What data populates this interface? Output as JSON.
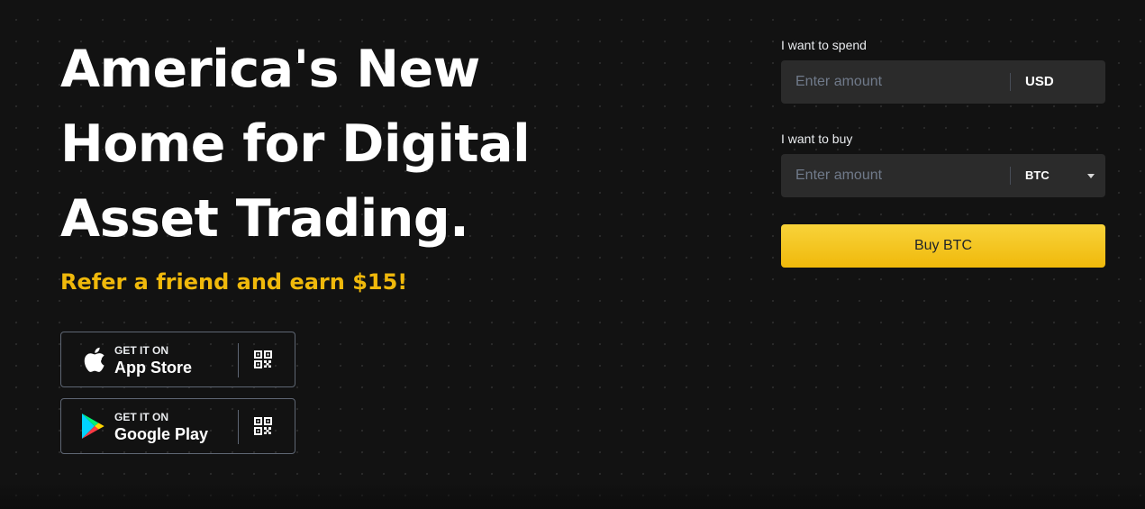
{
  "hero": {
    "title_lines": [
      "America's New",
      "Home for Digital",
      "Asset Trading."
    ],
    "promo": "Refer a friend and earn $15!"
  },
  "stores": [
    {
      "small": "GET IT ON",
      "name": "App Store",
      "icon": "apple-icon",
      "qr_icon": "qr-code-icon"
    },
    {
      "small": "GET IT ON",
      "name": "Google Play",
      "icon": "google-play-icon",
      "qr_icon": "qr-code-icon"
    }
  ],
  "buy_form": {
    "spend_label": "I want to spend",
    "spend_placeholder": "Enter amount",
    "spend_currency": "USD",
    "buy_label": "I want to buy",
    "buy_placeholder": "Enter amount",
    "buy_currency": "BTC",
    "submit_label": "Buy BTC"
  },
  "colors": {
    "background": "#121212",
    "accent": "#f0b90b",
    "input_bg": "#2b2b2b",
    "border": "#5e6673"
  }
}
